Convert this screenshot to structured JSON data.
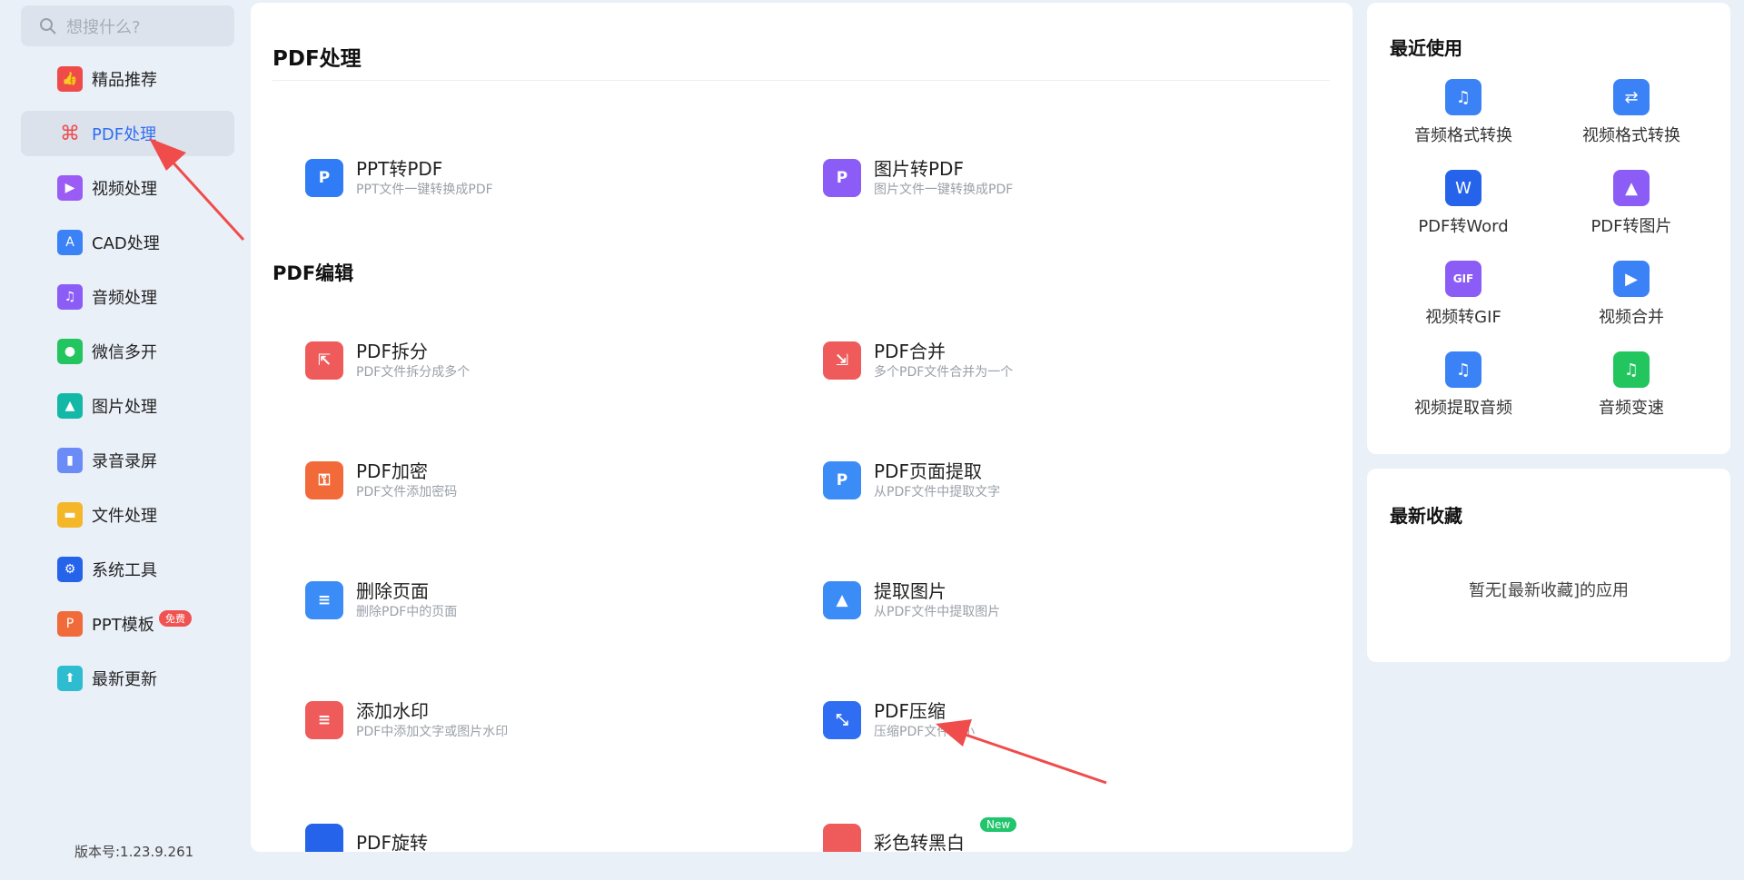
{
  "search": {
    "placeholder": "想搜什么?"
  },
  "sidebar": {
    "items": [
      {
        "label": "精品推荐",
        "icon": "thumbs-up-icon",
        "color": "#ef4b4b"
      },
      {
        "label": "PDF处理",
        "icon": "pdf-icon",
        "color": "#ef4b4b"
      },
      {
        "label": "视频处理",
        "icon": "play-icon",
        "color": "#9b5cf6"
      },
      {
        "label": "CAD处理",
        "icon": "cad-icon",
        "color": "#3b82f6"
      },
      {
        "label": "音频处理",
        "icon": "music-icon",
        "color": "#8b5cf6"
      },
      {
        "label": "微信多开",
        "icon": "wechat-icon",
        "color": "#22c55e"
      },
      {
        "label": "图片处理",
        "icon": "image-icon",
        "color": "#14b8a6"
      },
      {
        "label": "录音录屏",
        "icon": "mic-icon",
        "color": "#6b8cf6"
      },
      {
        "label": "文件处理",
        "icon": "folder-icon",
        "color": "#f5b72a"
      },
      {
        "label": "系统工具",
        "icon": "gear-icon",
        "color": "#2563eb"
      },
      {
        "label": "PPT模板",
        "icon": "ppt-icon",
        "color": "#f06a3a"
      },
      {
        "label": "最新更新",
        "icon": "upload-icon",
        "color": "#2dbcd0"
      }
    ],
    "active_index": 1,
    "ppt_badge": "免费",
    "version": "版本号:1.23.9.261"
  },
  "main": {
    "section1": "PDF处理",
    "section2": "PDF编辑",
    "tools": [
      {
        "name": "PPT转PDF",
        "desc": "PPT文件一键转换成PDF",
        "icon": "ppt-to-pdf-icon",
        "color": "#2f7cf6",
        "glyph": "P"
      },
      {
        "name": "图片转PDF",
        "desc": "图片文件一键转换成PDF",
        "icon": "image-to-pdf-icon",
        "color": "#8b5cf6",
        "glyph": "P"
      },
      {
        "name": "PDF拆分",
        "desc": "PDF文件拆分成多个",
        "icon": "split-icon",
        "color": "#ef5a5a",
        "glyph": "⇱"
      },
      {
        "name": "PDF合并",
        "desc": "多个PDF文件合并为一个",
        "icon": "merge-icon",
        "color": "#ef5a5a",
        "glyph": "⇲"
      },
      {
        "name": "PDF加密",
        "desc": "PDF文件添加密码",
        "icon": "lock-icon",
        "color": "#f26a3a",
        "glyph": "🔒"
      },
      {
        "name": "PDF页面提取",
        "desc": "从PDF文件中提取文字",
        "icon": "page-extract-icon",
        "color": "#3b8cf6",
        "glyph": "P"
      },
      {
        "name": "删除页面",
        "desc": "删除PDF中的页面",
        "icon": "delete-page-icon",
        "color": "#3b8cf6",
        "glyph": "≡"
      },
      {
        "name": "提取图片",
        "desc": "从PDF文件中提取图片",
        "icon": "extract-image-icon",
        "color": "#3b8cf6",
        "glyph": "▲"
      },
      {
        "name": "添加水印",
        "desc": "PDF中添加文字或图片水印",
        "icon": "watermark-icon",
        "color": "#ef5a5a",
        "glyph": "≡"
      },
      {
        "name": "PDF压缩",
        "desc": "压缩PDF文件大小",
        "icon": "compress-icon",
        "color": "#2f6ef2",
        "glyph": "⤡"
      },
      {
        "name": "PDF旋转",
        "desc": "",
        "icon": "rotate-icon",
        "color": "#2563eb",
        "glyph": ""
      },
      {
        "name": "彩色转黑白",
        "desc": "",
        "icon": "color-icon",
        "color": "#ef5a5a",
        "glyph": ""
      }
    ],
    "new_badge": "New"
  },
  "recent": {
    "title": "最近使用",
    "items": [
      {
        "label": "音频格式转换",
        "icon": "audio-convert-icon",
        "color": "#3b82f6",
        "glyph": "♫"
      },
      {
        "label": "视频格式转换",
        "icon": "video-convert-icon",
        "color": "#3b82f6",
        "glyph": "⇄"
      },
      {
        "label": "PDF转Word",
        "icon": "pdf-to-word-icon",
        "color": "#2563eb",
        "glyph": "W"
      },
      {
        "label": "PDF转图片",
        "icon": "pdf-to-image-icon",
        "color": "#8b5cf6",
        "glyph": "▲"
      },
      {
        "label": "视频转GIF",
        "icon": "video-to-gif-icon",
        "color": "#8b5cf6",
        "glyph": "GIF"
      },
      {
        "label": "视频合并",
        "icon": "video-merge-icon",
        "color": "#3b82f6",
        "glyph": "▶"
      },
      {
        "label": "视频提取音频",
        "icon": "extract-audio-icon",
        "color": "#3b82f6",
        "glyph": "♫"
      },
      {
        "label": "音频变速",
        "icon": "audio-speed-icon",
        "color": "#22c55e",
        "glyph": "♫"
      }
    ]
  },
  "favorites": {
    "title": "最新收藏",
    "empty": "暂无[最新收藏]的应用"
  }
}
